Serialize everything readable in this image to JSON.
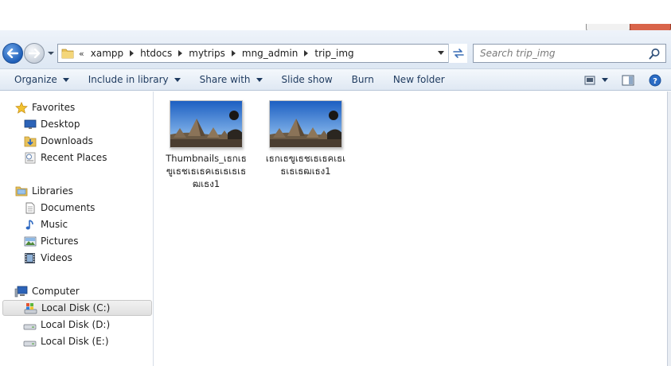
{
  "address": {
    "overflow": "«",
    "crumbs": [
      "xampp",
      "htdocs",
      "mytrips",
      "mng_admin",
      "trip_img"
    ]
  },
  "search": {
    "placeholder": "Search trip_img"
  },
  "toolbar": {
    "organize": "Organize",
    "include_in_library": "Include in library",
    "share_with": "Share with",
    "slide_show": "Slide show",
    "burn": "Burn",
    "new_folder": "New folder"
  },
  "nav": {
    "favorites": {
      "label": "Favorites",
      "items": [
        "Desktop",
        "Downloads",
        "Recent Places"
      ]
    },
    "libraries": {
      "label": "Libraries",
      "items": [
        "Documents",
        "Music",
        "Pictures",
        "Videos"
      ]
    },
    "computer": {
      "label": "Computer",
      "items": [
        "Local Disk (C:)",
        "Local Disk (D:)",
        "Local Disk (E:)"
      ],
      "selected": "Local Disk (C:)"
    }
  },
  "files": [
    {
      "name": "Thumbnails_เธกเธฃูเธชเธเธคเธเธเธเธฒเธง1"
    },
    {
      "name": "เธกเธฃูเธชเธเธคเธเธเธเธฒเธง1"
    }
  ],
  "colors": {
    "accent": "#1f5fb8",
    "toolbar_text": "#1e3a5f",
    "selected_bg": "#e6e6e6"
  }
}
